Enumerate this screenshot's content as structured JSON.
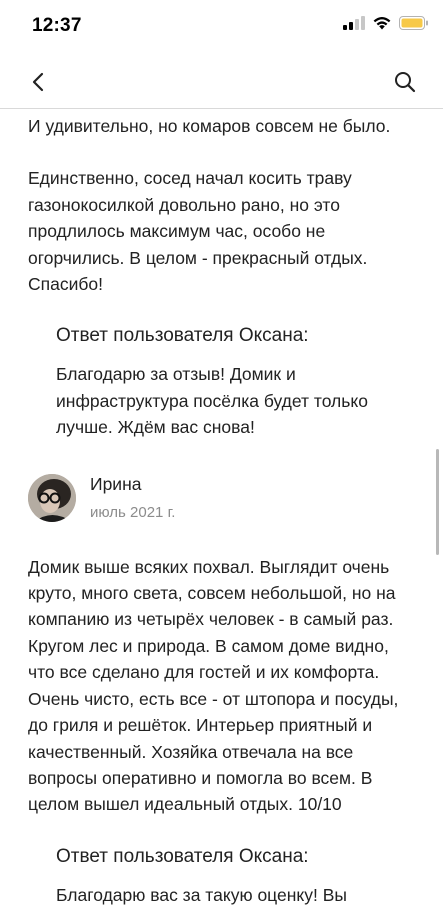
{
  "status_bar": {
    "time": "12:37"
  },
  "review1": {
    "paragraph_a": "И удивительно, но комаров совсем не было.",
    "paragraph_b": "Единственно, сосед начал косить траву газонокосилкой довольно рано, но это продлилось максимум час, особо не огорчились. В целом - прекрасный отдых. Спасибо!",
    "answer_title": "Ответ пользователя Оксана:",
    "answer_text": "Благодарю за отзыв! Домик и инфраструктура посёлка будет только лучше. Ждём вас снова!"
  },
  "review2": {
    "author_name": "Ирина",
    "author_date": "июль 2021 г.",
    "text": "Домик выше всяких похвал. Выглядит очень круто, много света, совсем небольшой, но на компанию из четырёх человек - в самый раз. Кругом лес и природа. В самом доме видно, что все сделано для гостей и их комфорта. Очень чисто, есть все - от штопора и посуды, до гриля и решёток. Интерьер приятный и качественный. Хозяйка отвечала на все вопросы оперативно и помогла во всем. В целом вышел идеальный отдых. 10/10",
    "answer_title": "Ответ пользователя Оксана:",
    "answer_text": "Благодарю вас за такую оценку! Вы волшебные гости!"
  },
  "icons": {
    "back": "chevron-left-icon",
    "search": "search-icon",
    "signal": "cellular-signal-icon",
    "wifi": "wifi-icon",
    "battery": "battery-icon"
  },
  "colors": {
    "text": "#222222",
    "secondary_text": "#8c8c8c",
    "battery": "#f7c948",
    "divider": "#d9d9d9"
  }
}
